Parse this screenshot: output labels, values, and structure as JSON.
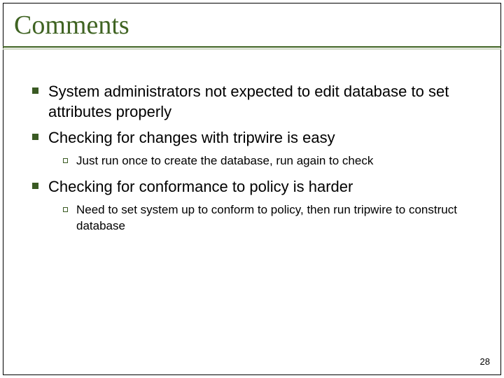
{
  "title": "Comments",
  "bullets": [
    {
      "text": "System administrators not expected to edit database to set attributes properly",
      "sub": []
    },
    {
      "text": "Checking for changes with tripwire is easy",
      "sub": [
        "Just run once to create the database, run again to check"
      ]
    },
    {
      "text": "Checking for conformance to policy is harder",
      "sub": [
        "Need to set system up to conform to policy, then run tripwire to construct database"
      ]
    }
  ],
  "page_number": "28"
}
